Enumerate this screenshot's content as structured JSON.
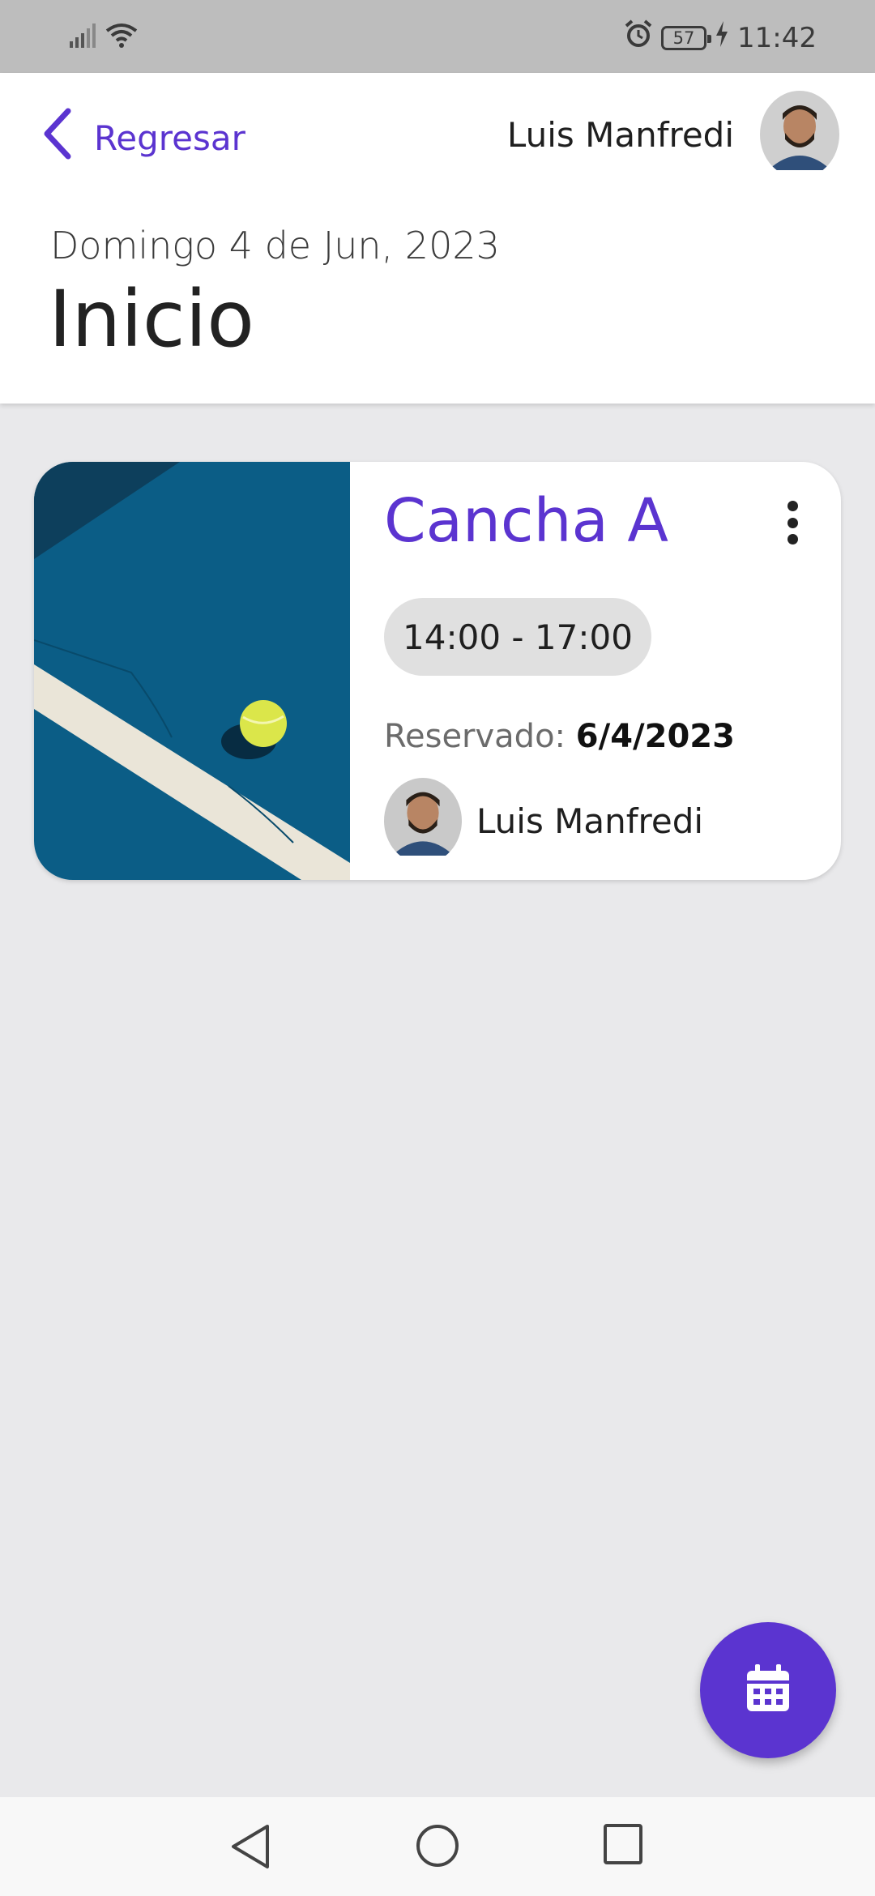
{
  "status_bar": {
    "battery": "57",
    "time": "11:42"
  },
  "header": {
    "back_label": "Regresar",
    "user_name": "Luis Manfredi",
    "date": "Domingo 4 de Jun, 2023",
    "title": "Inicio"
  },
  "booking": {
    "court": "Cancha A",
    "time_range": "14:00 - 17:00",
    "reserved_label": "Reservado:",
    "reserved_date": "6/4/2023",
    "user_name": "Luis Manfredi"
  },
  "colors": {
    "accent": "#5b34d0",
    "court_blue": "#0b5d86",
    "status_bar": "#bdbdbd"
  }
}
